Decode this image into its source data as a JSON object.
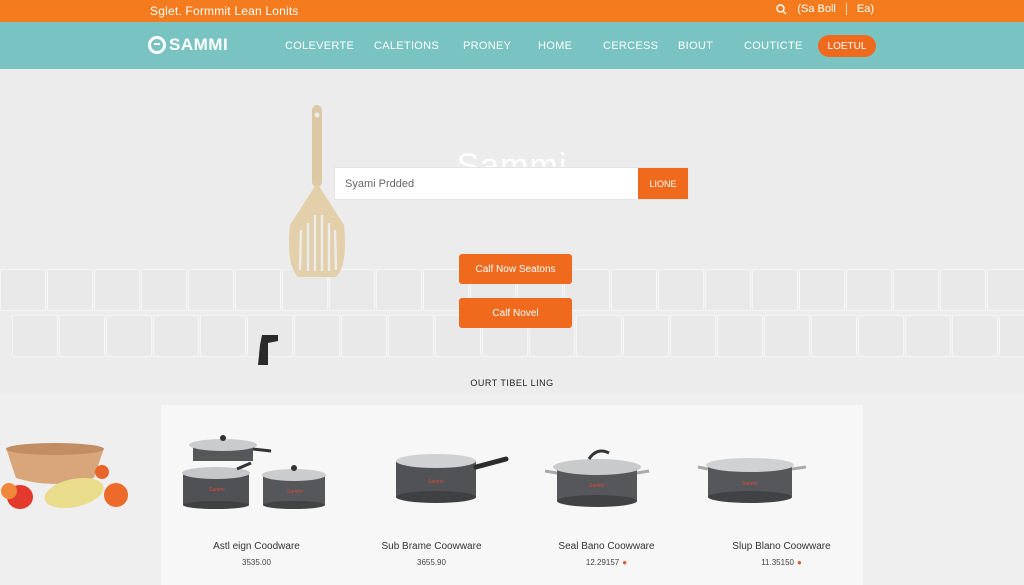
{
  "topbar": {
    "promo": "Sglet. Formmit Lean Lonits",
    "search_label": "(Sa Boll",
    "lang": "Ea)"
  },
  "nav": {
    "logo": "SAMMI",
    "links": [
      "COLEVERTE",
      "CALETIONS",
      "PRONEY",
      "HOME",
      "CERCESS",
      "BIOUT",
      "COUTICTE"
    ],
    "login": "LOETUL"
  },
  "hero": {
    "title": "Sammi",
    "search_placeholder": "Syami Prdded",
    "search_button": "LIONE",
    "cta_primary": "Calf Now Seatons",
    "cta_secondary": "Calf Novel"
  },
  "section_title": "OURT TIBEL LING",
  "products": [
    {
      "name": "Astl eign Coodware",
      "price": "3535.00"
    },
    {
      "name": "Sub Brame Coowware",
      "price": "3655.90"
    },
    {
      "name": "Seal Bano Coowware",
      "price": "12.29157"
    },
    {
      "name": "Slup Blano Coowware",
      "price": "11.35150"
    }
  ],
  "colors": {
    "accent": "#f06a1e",
    "topbar": "#f47c1e",
    "nav": "#79c4c2",
    "background": "#efefef"
  }
}
